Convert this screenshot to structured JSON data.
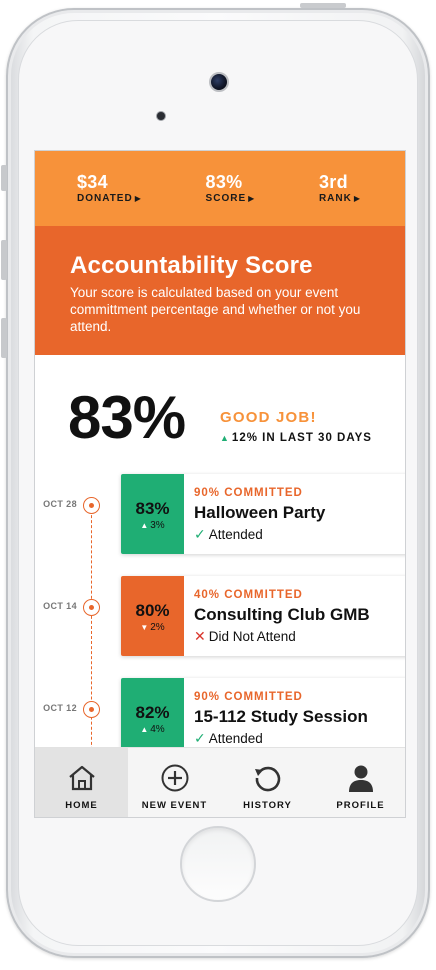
{
  "stats": {
    "donated": {
      "value": "$34",
      "label": "DONATED"
    },
    "score": {
      "value": "83%",
      "label": "SCORE"
    },
    "rank": {
      "value": "3rd",
      "label": "RANK"
    }
  },
  "header": {
    "title": "Accountability Score",
    "description": "Your score is calculated based on your event committment percentage and whether or not you attend."
  },
  "summary": {
    "score": "83%",
    "message": "GOOD JOB!",
    "trend": "12% IN LAST 30 DAYS"
  },
  "events": [
    {
      "date": "OCT 28",
      "score": "83%",
      "delta": "3%",
      "delta_direction": "up",
      "committed": "90% COMMITTED",
      "name": "Halloween Party",
      "status": "Attended",
      "status_icon": "check-icon",
      "badge_color": "#1fae74"
    },
    {
      "date": "OCT 14",
      "score": "80%",
      "delta": "2%",
      "delta_direction": "down",
      "committed": "40% COMMITTED",
      "name": "Consulting Club GMB",
      "status": "Did Not Attend",
      "status_icon": "x-icon",
      "badge_color": "#e8662b"
    },
    {
      "date": "OCT 12",
      "score": "82%",
      "delta": "4%",
      "delta_direction": "up",
      "committed": "90% COMMITTED",
      "name": "15-112 Study Session",
      "status": "Attended",
      "status_icon": "check-icon",
      "badge_color": "#1fae74"
    }
  ],
  "tabs": [
    {
      "label": "HOME",
      "icon": "home-icon",
      "active": true
    },
    {
      "label": "NEW EVENT",
      "icon": "plus-circle-icon",
      "active": false
    },
    {
      "label": "HISTORY",
      "icon": "history-icon",
      "active": false
    },
    {
      "label": "PROFILE",
      "icon": "profile-icon",
      "active": false
    }
  ],
  "colors": {
    "stats_bar": "#f7923a",
    "header": "#e8662b",
    "green": "#1fae74",
    "red_x": "#d9352b"
  }
}
